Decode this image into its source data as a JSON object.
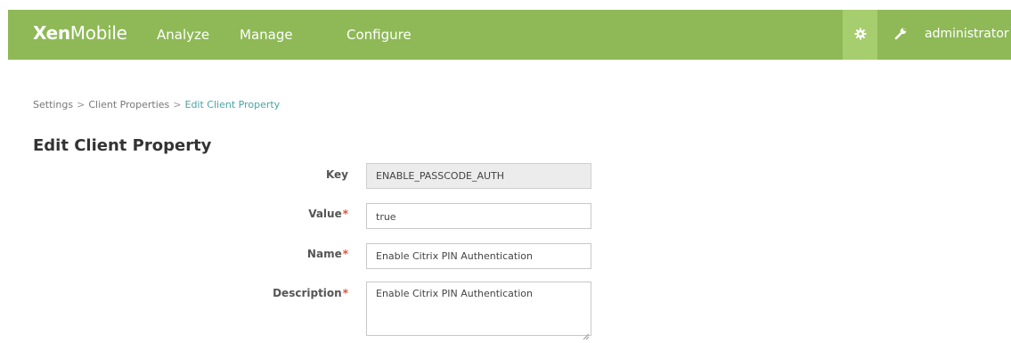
{
  "header": {
    "logo_bold": "Xen",
    "logo_light": "Mobile",
    "nav": [
      {
        "label": "Analyze"
      },
      {
        "label": "Manage"
      },
      {
        "label": "Configure"
      }
    ],
    "user": "administrator",
    "icons": {
      "settings": "gear-icon",
      "support": "wrench-icon",
      "dropdown": "chevron-down-icon"
    },
    "colors": {
      "bar": "#8eb956",
      "active": "#a6cd6e"
    }
  },
  "breadcrumb": {
    "items": [
      "Settings",
      "Client Properties"
    ],
    "separator": ">",
    "current": "Edit Client Property"
  },
  "page": {
    "title": "Edit Client Property"
  },
  "form": {
    "key": {
      "label": "Key",
      "value": "ENABLE_PASSCODE_AUTH"
    },
    "value": {
      "label": "Value",
      "required": "*",
      "value": "true"
    },
    "name": {
      "label": "Name",
      "required": "*",
      "value": "Enable Citrix PIN Authentication"
    },
    "description": {
      "label": "Description",
      "required": "*",
      "value": "Enable Citrix PIN Authentication"
    }
  }
}
